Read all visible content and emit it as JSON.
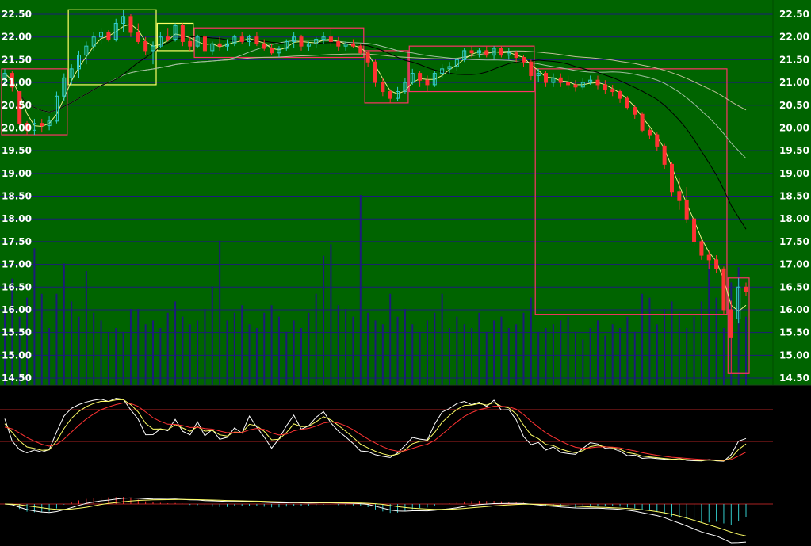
{
  "chart_data": [
    {
      "type": "candlestick",
      "panel": "price",
      "title": "",
      "background": "#006400",
      "y_ticks": [
        "22.50",
        "22.00",
        "21.50",
        "21.00",
        "20.50",
        "20.00",
        "19.50",
        "19.00",
        "18.50",
        "18.00",
        "17.50",
        "17.00",
        "16.50",
        "16.00",
        "15.50",
        "15.00",
        "14.50"
      ],
      "ylim": [
        14.5,
        22.5
      ],
      "up_color": "#33cccc",
      "down_color": "#ff3333",
      "candles": [
        [
          21.1,
          21.3,
          20.95,
          21.2
        ],
        [
          21.2,
          21.25,
          20.8,
          20.9
        ],
        [
          20.8,
          20.8,
          20.0,
          20.1
        ],
        [
          20.1,
          20.15,
          19.85,
          19.95
        ],
        [
          19.95,
          20.2,
          19.85,
          20.1
        ],
        [
          20.1,
          20.2,
          19.9,
          20.05
        ],
        [
          20.05,
          20.25,
          19.95,
          20.15
        ],
        [
          20.15,
          20.8,
          20.1,
          20.7
        ],
        [
          20.7,
          21.2,
          20.6,
          21.1
        ],
        [
          21.1,
          21.4,
          20.95,
          21.3
        ],
        [
          21.3,
          21.7,
          21.1,
          21.6
        ],
        [
          21.6,
          21.9,
          21.4,
          21.8
        ],
        [
          21.8,
          22.1,
          21.7,
          22.0
        ],
        [
          22.0,
          22.2,
          21.85,
          22.1
        ],
        [
          22.1,
          22.15,
          21.9,
          21.95
        ],
        [
          21.95,
          22.4,
          21.9,
          22.3
        ],
        [
          22.3,
          22.6,
          22.1,
          22.45
        ],
        [
          22.45,
          22.5,
          22.0,
          22.1
        ],
        [
          22.1,
          22.3,
          21.85,
          21.9
        ],
        [
          21.9,
          22.0,
          21.6,
          21.7
        ],
        [
          21.7,
          21.9,
          21.4,
          21.8
        ],
        [
          21.8,
          22.1,
          21.75,
          22.0
        ],
        [
          22.0,
          22.2,
          21.9,
          21.95
        ],
        [
          21.95,
          22.3,
          21.9,
          22.25
        ],
        [
          22.25,
          22.3,
          21.8,
          21.9
        ],
        [
          21.9,
          22.0,
          21.7,
          21.8
        ],
        [
          21.8,
          22.05,
          21.75,
          22.0
        ],
        [
          22.0,
          22.1,
          21.6,
          21.7
        ],
        [
          21.7,
          21.9,
          21.6,
          21.85
        ],
        [
          21.85,
          22.0,
          21.7,
          21.8
        ],
        [
          21.8,
          21.95,
          21.7,
          21.85
        ],
        [
          21.85,
          22.05,
          21.8,
          22.0
        ],
        [
          22.0,
          22.1,
          21.85,
          21.9
        ],
        [
          21.9,
          22.05,
          21.8,
          22.0
        ],
        [
          22.0,
          22.1,
          21.8,
          21.85
        ],
        [
          21.85,
          21.95,
          21.7,
          21.75
        ],
        [
          21.75,
          21.85,
          21.6,
          21.65
        ],
        [
          21.65,
          21.8,
          21.55,
          21.75
        ],
        [
          21.75,
          21.95,
          21.7,
          21.9
        ],
        [
          21.9,
          22.1,
          21.75,
          22.0
        ],
        [
          22.0,
          22.05,
          21.7,
          21.8
        ],
        [
          21.8,
          21.9,
          21.7,
          21.85
        ],
        [
          21.85,
          22.0,
          21.75,
          21.95
        ],
        [
          21.95,
          22.1,
          21.85,
          22.0
        ],
        [
          22.0,
          22.2,
          21.8,
          21.9
        ],
        [
          21.9,
          22.0,
          21.7,
          21.8
        ],
        [
          21.8,
          21.9,
          21.7,
          21.85
        ],
        [
          21.85,
          21.95,
          21.75,
          21.8
        ],
        [
          21.8,
          21.85,
          21.6,
          21.65
        ],
        [
          21.65,
          21.7,
          21.35,
          21.45
        ],
        [
          21.45,
          21.5,
          20.9,
          21.0
        ],
        [
          21.0,
          21.1,
          20.7,
          20.8
        ],
        [
          20.8,
          20.85,
          20.55,
          20.65
        ],
        [
          20.65,
          20.9,
          20.6,
          20.8
        ],
        [
          20.8,
          21.1,
          20.75,
          21.0
        ],
        [
          21.0,
          21.3,
          20.95,
          21.2
        ],
        [
          21.2,
          21.25,
          20.9,
          21.05
        ],
        [
          21.05,
          21.15,
          20.8,
          20.95
        ],
        [
          20.95,
          21.25,
          20.9,
          21.2
        ],
        [
          21.2,
          21.4,
          21.1,
          21.3
        ],
        [
          21.3,
          21.45,
          21.2,
          21.35
        ],
        [
          21.35,
          21.55,
          21.25,
          21.5
        ],
        [
          21.5,
          21.75,
          21.45,
          21.7
        ],
        [
          21.7,
          21.8,
          21.55,
          21.65
        ],
        [
          21.65,
          21.75,
          21.55,
          21.7
        ],
        [
          21.7,
          21.8,
          21.55,
          21.6
        ],
        [
          21.6,
          21.8,
          21.5,
          21.75
        ],
        [
          21.75,
          21.8,
          21.55,
          21.6
        ],
        [
          21.6,
          21.75,
          21.5,
          21.65
        ],
        [
          21.65,
          21.7,
          21.45,
          21.55
        ],
        [
          21.55,
          21.6,
          21.35,
          21.45
        ],
        [
          21.45,
          21.5,
          21.05,
          21.15
        ],
        [
          21.15,
          21.3,
          21.0,
          21.2
        ],
        [
          21.2,
          21.25,
          20.9,
          21.0
        ],
        [
          21.0,
          21.2,
          20.9,
          21.1
        ],
        [
          21.1,
          21.2,
          20.9,
          21.0
        ],
        [
          21.0,
          21.15,
          20.85,
          20.95
        ],
        [
          20.95,
          21.05,
          20.8,
          20.9
        ],
        [
          20.9,
          21.1,
          20.85,
          21.0
        ],
        [
          21.0,
          21.15,
          20.95,
          21.05
        ],
        [
          21.05,
          21.15,
          20.85,
          20.95
        ],
        [
          20.95,
          21.05,
          20.75,
          20.85
        ],
        [
          20.85,
          20.95,
          20.7,
          20.8
        ],
        [
          20.8,
          20.85,
          20.55,
          20.65
        ],
        [
          20.65,
          20.7,
          20.4,
          20.45
        ],
        [
          20.45,
          20.5,
          20.2,
          20.3
        ],
        [
          20.3,
          20.35,
          19.9,
          19.95
        ],
        [
          19.95,
          20.0,
          19.75,
          19.85
        ],
        [
          19.85,
          19.9,
          19.5,
          19.6
        ],
        [
          19.6,
          19.65,
          19.1,
          19.2
        ],
        [
          19.2,
          19.25,
          18.5,
          18.6
        ],
        [
          18.6,
          18.9,
          18.2,
          18.4
        ],
        [
          18.4,
          18.7,
          17.9,
          18.0
        ],
        [
          18.0,
          18.05,
          17.4,
          17.5
        ],
        [
          17.5,
          17.55,
          17.1,
          17.2
        ],
        [
          17.2,
          17.3,
          16.9,
          17.1
        ],
        [
          17.1,
          17.2,
          16.8,
          16.9
        ],
        [
          16.9,
          16.95,
          15.9,
          16.0
        ],
        [
          16.0,
          16.2,
          14.6,
          15.4
        ],
        [
          15.8,
          16.7,
          15.7,
          16.5
        ],
        [
          16.5,
          16.6,
          16.3,
          16.4
        ]
      ],
      "volume": [
        1.9,
        2.8,
        1.8,
        2.3,
        3.6,
        2.4,
        1.5,
        2.4,
        3.2,
        2.2,
        1.8,
        3.0,
        1.9,
        1.7,
        1.4,
        1.5,
        1.4,
        2.0,
        2.0,
        1.6,
        1.7,
        1.5,
        1.9,
        2.2,
        1.8,
        1.6,
        1.7,
        2.0,
        2.6,
        3.8,
        1.7,
        1.9,
        2.1,
        1.6,
        1.5,
        1.9,
        2.1,
        1.8,
        1.4,
        1.7,
        1.5,
        1.9,
        2.4,
        3.4,
        3.7,
        2.1,
        2.0,
        1.8,
        5.0,
        1.9,
        1.7,
        1.6,
        2.4,
        1.8,
        2.0,
        1.6,
        1.4,
        1.7,
        1.9,
        2.4,
        1.5,
        1.8,
        1.6,
        1.5,
        1.9,
        1.4,
        1.7,
        1.8,
        1.5,
        1.6,
        1.9,
        2.3,
        1.4,
        1.5,
        1.6,
        1.7,
        1.8,
        1.4,
        1.2,
        1.5,
        1.7,
        1.3,
        1.6,
        1.5,
        1.8,
        1.4,
        2.4,
        2.3,
        1.6,
        2.0,
        2.2,
        1.9,
        1.5,
        1.8,
        2.2,
        3.2,
        2.3,
        1.5,
        2.7,
        3.1,
        1.8
      ]
    },
    {
      "type": "line",
      "panel": "oscillator",
      "title": "",
      "series_colors": [
        "#ffffff",
        "#ffff66",
        "#ff3333"
      ]
    },
    {
      "type": "line",
      "panel": "macd",
      "title": "",
      "series_colors": [
        "#ffffff",
        "#ffff66",
        "#ff3333"
      ]
    }
  ]
}
